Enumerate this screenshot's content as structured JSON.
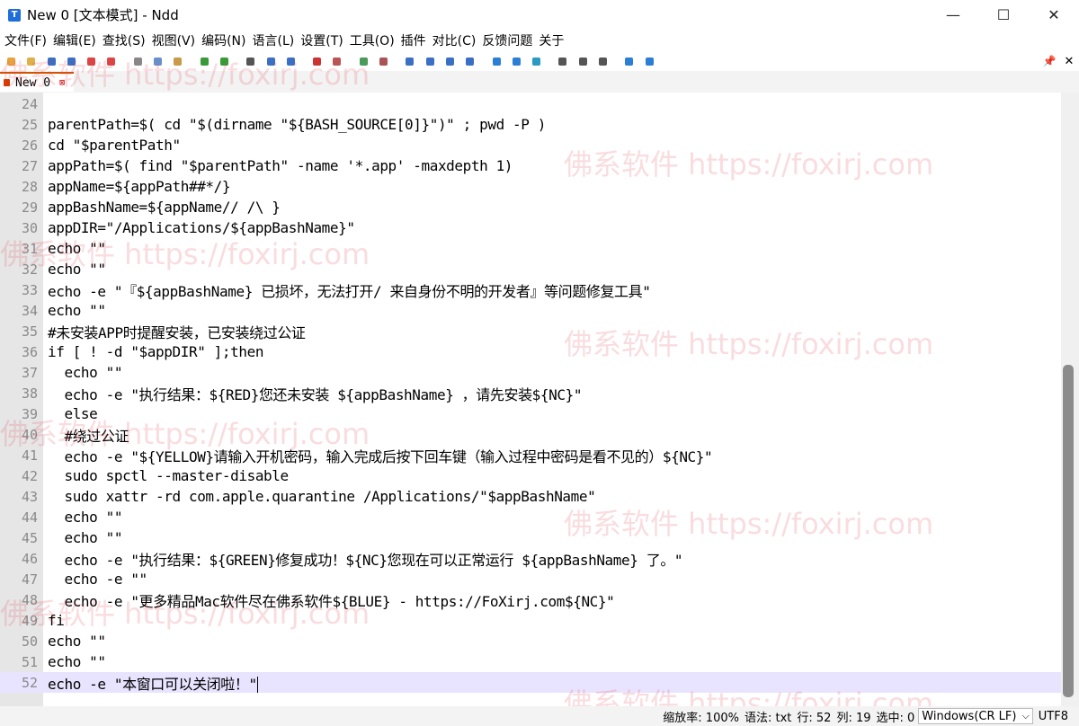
{
  "window": {
    "title": "New 0 [文本模式] - Ndd",
    "app_icon": "T",
    "minimize": "—",
    "maximize": "☐",
    "close": "✕"
  },
  "menu": [
    "文件(F)",
    "编辑(E)",
    "查找(S)",
    "视图(V)",
    "编码(N)",
    "语言(L)",
    "设置(T)",
    "工具(O)",
    "插件",
    "对比(C)",
    "反馈问题",
    "关于"
  ],
  "toolbar": {
    "icons": [
      {
        "name": "new-file-icon",
        "color": "#e8a33d"
      },
      {
        "name": "open-file-icon",
        "color": "#e0b04a"
      },
      {
        "name": "save-icon",
        "color": "#3a6fc4"
      },
      {
        "name": "save-all-icon",
        "color": "#3a6fc4"
      },
      {
        "name": "close-file-icon",
        "color": "#d44"
      },
      {
        "name": "close-all-icon",
        "color": "#d44"
      },
      {
        "name": "cut-icon",
        "color": "#888"
      },
      {
        "name": "copy-icon",
        "color": "#6a8fc8"
      },
      {
        "name": "paste-icon",
        "color": "#c89a4a"
      },
      {
        "name": "undo-icon",
        "color": "#3a9a3a"
      },
      {
        "name": "redo-icon",
        "color": "#3a9a3a"
      },
      {
        "name": "find-icon",
        "color": "#555"
      },
      {
        "name": "replace-icon",
        "color": "#3a6fc4"
      },
      {
        "name": "goto-icon",
        "color": "#3a6fc4"
      },
      {
        "name": "mark-icon",
        "color": "#c33"
      },
      {
        "name": "clear-mark-icon",
        "color": "#b55"
      },
      {
        "name": "zoom-in-icon",
        "color": "#4a9a5a"
      },
      {
        "name": "zoom-out-icon",
        "color": "#a55"
      },
      {
        "name": "wrap-icon",
        "color": "#3a6fc4"
      },
      {
        "name": "show-symbol-icon",
        "color": "#3a6fc4"
      },
      {
        "name": "indent-guide-icon",
        "color": "#3a6fc4"
      },
      {
        "name": "record-icon",
        "color": "#3a6fc4"
      },
      {
        "name": "prev-icon",
        "color": "#2a7fd4"
      },
      {
        "name": "next-icon",
        "color": "#2a7fd4"
      },
      {
        "name": "link-icon",
        "color": "#2a9ac4"
      },
      {
        "name": "column-icon",
        "color": "#555"
      },
      {
        "name": "panel-icon",
        "color": "#555"
      },
      {
        "name": "monitor-icon",
        "color": "#555"
      },
      {
        "name": "compare-icon",
        "color": "#2a7fd4"
      },
      {
        "name": "bracket-icon",
        "color": "#2a7fd4"
      }
    ],
    "pin": "📌",
    "close": "✕"
  },
  "tab": {
    "label": "New 0",
    "close": "⊠"
  },
  "editor": {
    "lines": [
      {
        "n": "24",
        "text": ""
      },
      {
        "n": "25",
        "text": "parentPath=$( cd \"$(dirname \"${BASH_SOURCE[0]}\")\" ; pwd -P )"
      },
      {
        "n": "26",
        "text": "cd \"$parentPath\""
      },
      {
        "n": "27",
        "text": "appPath=$( find \"$parentPath\" -name '*.app' -maxdepth 1)"
      },
      {
        "n": "28",
        "text": "appName=${appPath##*/}"
      },
      {
        "n": "29",
        "text": "appBashName=${appName// /\\ }"
      },
      {
        "n": "30",
        "text": "appDIR=\"/Applications/${appBashName}\""
      },
      {
        "n": "31",
        "text": "echo \"\""
      },
      {
        "n": "32",
        "text": "echo \"\""
      },
      {
        "n": "33",
        "text": "echo -e \"『${appBashName} 已损坏，无法打开/ 来自身份不明的开发者』等问题修复工具\""
      },
      {
        "n": "34",
        "text": "echo \"\""
      },
      {
        "n": "35",
        "text": "#未安装APP时提醒安装，已安装绕过公证"
      },
      {
        "n": "36",
        "text": "if [ ! -d \"$appDIR\" ];then"
      },
      {
        "n": "37",
        "text": "  echo \"\""
      },
      {
        "n": "38",
        "text": "  echo -e \"执行结果：${RED}您还未安装 ${appBashName} ，请先安装${NC}\""
      },
      {
        "n": "39",
        "text": "  else"
      },
      {
        "n": "40",
        "text": "  #绕过公证"
      },
      {
        "n": "41",
        "text": "  echo -e \"${YELLOW}请输入开机密码，输入完成后按下回车键（输入过程中密码是看不见的）${NC}\""
      },
      {
        "n": "42",
        "text": "  sudo spctl --master-disable"
      },
      {
        "n": "43",
        "text": "  sudo xattr -rd com.apple.quarantine /Applications/\"$appBashName\""
      },
      {
        "n": "44",
        "text": "  echo \"\""
      },
      {
        "n": "45",
        "text": "  echo \"\""
      },
      {
        "n": "46",
        "text": "  echo -e \"执行结果：${GREEN}修复成功！${NC}您现在可以正常运行 ${appBashName} 了。\""
      },
      {
        "n": "47",
        "text": "  echo -e \"\""
      },
      {
        "n": "48",
        "text": "  echo -e \"更多精品Mac软件尽在佛系软件${BLUE} - https://FoXirj.com${NC}\""
      },
      {
        "n": "49",
        "text": "fi"
      },
      {
        "n": "50",
        "text": "echo \"\""
      },
      {
        "n": "51",
        "text": "echo \"\""
      },
      {
        "n": "52",
        "text": "echo -e \"本窗口可以关闭啦！\""
      }
    ],
    "current_line": "52"
  },
  "watermark": "佛系软件 https://foxirj.com",
  "status": {
    "zoom": "缩放率: 100%",
    "lang": "语法: txt",
    "line": "行: 52",
    "col": "列: 19",
    "sel": "选中: 0",
    "eol": "Windows(CR LF)",
    "eol_arrow": "⌵",
    "encoding": "UTF8"
  }
}
